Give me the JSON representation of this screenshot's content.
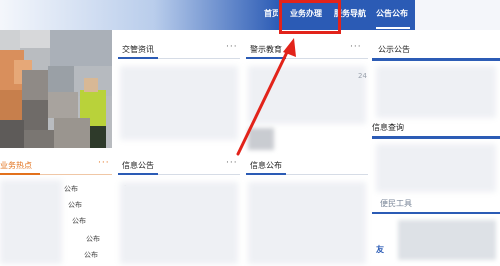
{
  "nav": {
    "home_label": "首页",
    "business_label": "业务办理",
    "guide_label": "服务导航",
    "notice_label": "公告公布"
  },
  "sections": {
    "traffic_news": {
      "title": "交管资讯",
      "more": "···"
    },
    "warning_education": {
      "title": "警示教育",
      "more": "···"
    },
    "public_notice": {
      "title": "公示公告"
    },
    "business_hot": {
      "title": "业务热点",
      "more": "···"
    },
    "info_notice": {
      "title": "信息公告",
      "more": "···"
    },
    "info_publish": {
      "title": "信息公布"
    },
    "info_query": {
      "title": "信息查询"
    },
    "convenience_tools": {
      "title": "便民工具"
    },
    "links": {
      "title": "友"
    }
  },
  "hot_list": [
    "公布",
    "公布",
    "公布",
    "公布",
    "公布",
    "公布",
    "公布"
  ],
  "warning_digits": "24",
  "info_notice_marker": "·",
  "colors": {
    "nav_blue": "#2b5bb5",
    "accent_orange": "#e2701a",
    "highlight_red": "#e2231a"
  }
}
